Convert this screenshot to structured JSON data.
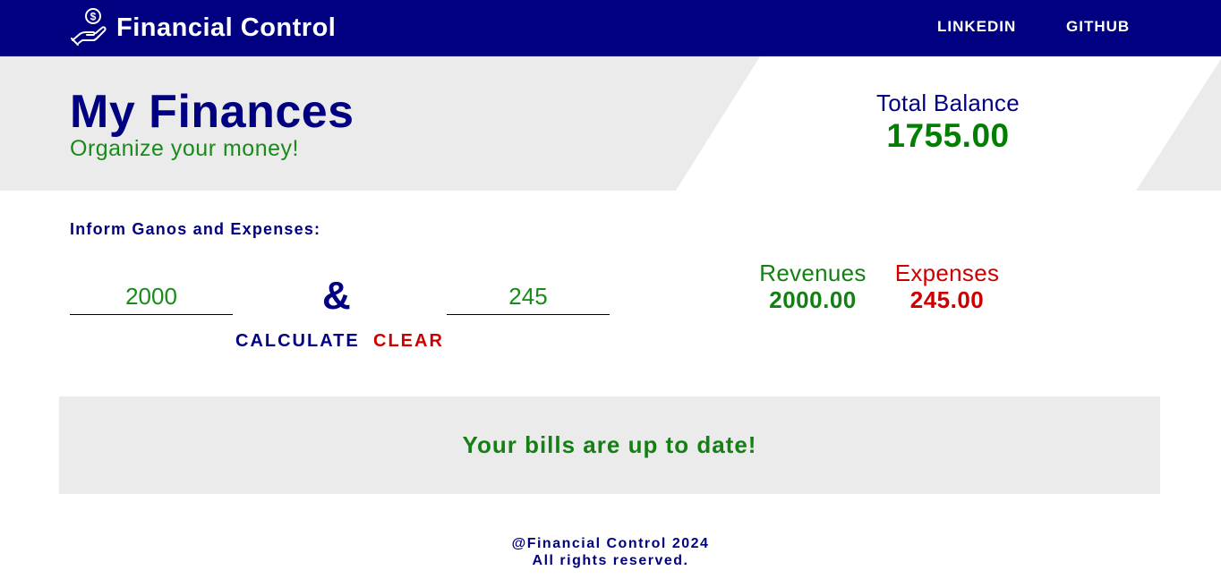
{
  "navbar": {
    "brand_name": "Financial Control",
    "brand_icon": "hand-holding-dollar-icon",
    "links": {
      "linkedin": "LINKEDIN",
      "github": "GITHUB"
    },
    "background_color": "#000080"
  },
  "hero": {
    "title": "My Finances",
    "subtitle": "Organize your money!",
    "balance_label": "Total Balance",
    "balance_value": "1755.00"
  },
  "form": {
    "label": "Inform Ganos and Expenses:",
    "revenue_value": "2000",
    "expense_value": "245",
    "separator": "&",
    "calculate_label": "CALCULATE",
    "clear_label": "CLEAR"
  },
  "summary": {
    "revenues_label": "Revenues",
    "revenues_value": "2000.00",
    "expenses_label": "Expenses",
    "expenses_value": "245.00"
  },
  "status": {
    "message": "Your bills are up to date!"
  },
  "footer": {
    "line1": "@Financial Control 2024",
    "line2": "All rights reserved."
  },
  "colors": {
    "primary": "#000080",
    "positive": "#148014",
    "negative": "#cc0000",
    "panel": "#ebebeb"
  }
}
